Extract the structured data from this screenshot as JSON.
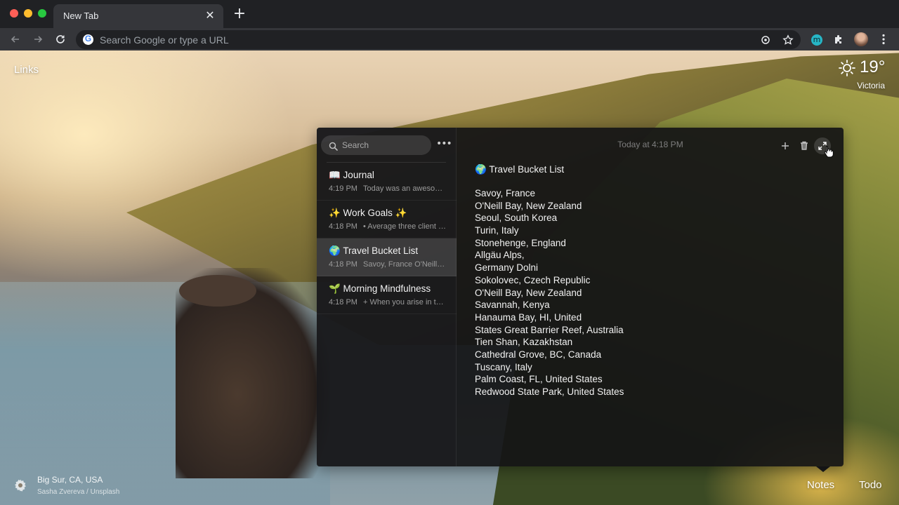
{
  "browser": {
    "tab_title": "New Tab",
    "tab_close": "✕",
    "new_tab": "+",
    "omnibox_placeholder": "Search Google or type a URL",
    "google_letter": "G",
    "extension_letter": "m"
  },
  "dashboard": {
    "links_label": "Links",
    "weather": {
      "temperature": "19°",
      "location": "Victoria"
    },
    "photo": {
      "location": "Big Sur, CA, USA",
      "credit": "Sasha Zvereva / Unsplash"
    },
    "bottom_nav": {
      "notes": "Notes",
      "todo": "Todo"
    }
  },
  "notes": {
    "search_placeholder": "Search",
    "more_label": "•••",
    "list": [
      {
        "title": "📖 Journal",
        "time": "4:19 PM",
        "preview": "Today was an awesome day"
      },
      {
        "title": "✨ Work Goals ✨",
        "time": "4:18 PM",
        "preview": "• Average three client calls"
      },
      {
        "title": "🌍 Travel Bucket List",
        "time": "4:18 PM",
        "preview": "Savoy, France O'Neill Bay"
      },
      {
        "title": "🌱 Morning Mindfulness",
        "time": "4:18 PM",
        "preview": "+ When you arise in the morning"
      }
    ],
    "active_index": 2,
    "editor": {
      "timestamp": "Today at 4:18 PM",
      "heading": "🌍 Travel Bucket List",
      "lines": [
        "Savoy, France",
        "O'Neill Bay, New Zealand",
        "Seoul, South Korea",
        "Turin, Italy",
        "Stonehenge, England",
        "Allgäu Alps,",
        "Germany Dolni",
        "Sokolovec, Czech Republic",
        "O'Neill Bay, New Zealand",
        "Savannah, Kenya",
        "Hanauma Bay, HI, United",
        "States Great Barrier Reef, Australia",
        "Tien Shan, Kazakhstan",
        "Cathedral Grove, BC, Canada",
        "Tuscany, Italy",
        "Palm Coast, FL, United States",
        "Redwood State Park, United States"
      ]
    }
  },
  "icons": {
    "back": "arrow-left-icon",
    "forward": "arrow-right-icon",
    "reload": "reload-icon",
    "lens": "lens-icon",
    "star": "star-icon",
    "puzzle": "puzzle-icon",
    "menu": "vertical-dots-icon",
    "weather": "sun-icon",
    "settings": "gear-icon",
    "add": "plus-icon",
    "trash": "trash-icon",
    "expand": "expand-icon"
  }
}
